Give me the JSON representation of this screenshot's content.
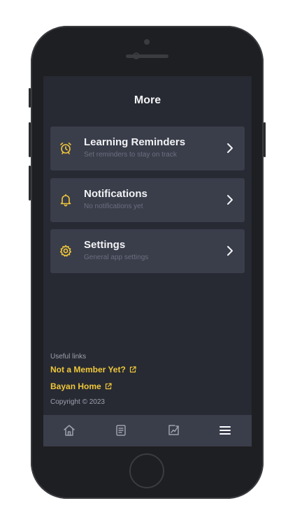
{
  "header": {
    "title": "More"
  },
  "menu": {
    "items": [
      {
        "label": "Learning Reminders",
        "subtitle": "Set reminders to stay on track",
        "icon": "alarm-clock-icon"
      },
      {
        "label": "Notifications",
        "subtitle": "No notifications yet",
        "icon": "bell-icon"
      },
      {
        "label": "Settings",
        "subtitle": "General app settings",
        "icon": "gear-icon"
      }
    ]
  },
  "footer": {
    "useful_links_label": "Useful links",
    "links": [
      {
        "label": "Not a Member Yet?",
        "icon": "external-link-icon"
      },
      {
        "label": "Bayan Home",
        "icon": "external-link-icon"
      }
    ],
    "copyright": "Copyright © 2023"
  },
  "tabbar": {
    "tabs": [
      {
        "icon": "home-icon",
        "active": false
      },
      {
        "icon": "book-icon",
        "active": false
      },
      {
        "icon": "chart-icon",
        "active": false
      },
      {
        "icon": "menu-icon",
        "active": true
      }
    ]
  },
  "colors": {
    "accent": "#f0c73a",
    "screen_bg": "#272a33",
    "card_bg": "#3a3d4a",
    "text_primary": "#f2f3f5",
    "text_muted": "#6c7080"
  }
}
